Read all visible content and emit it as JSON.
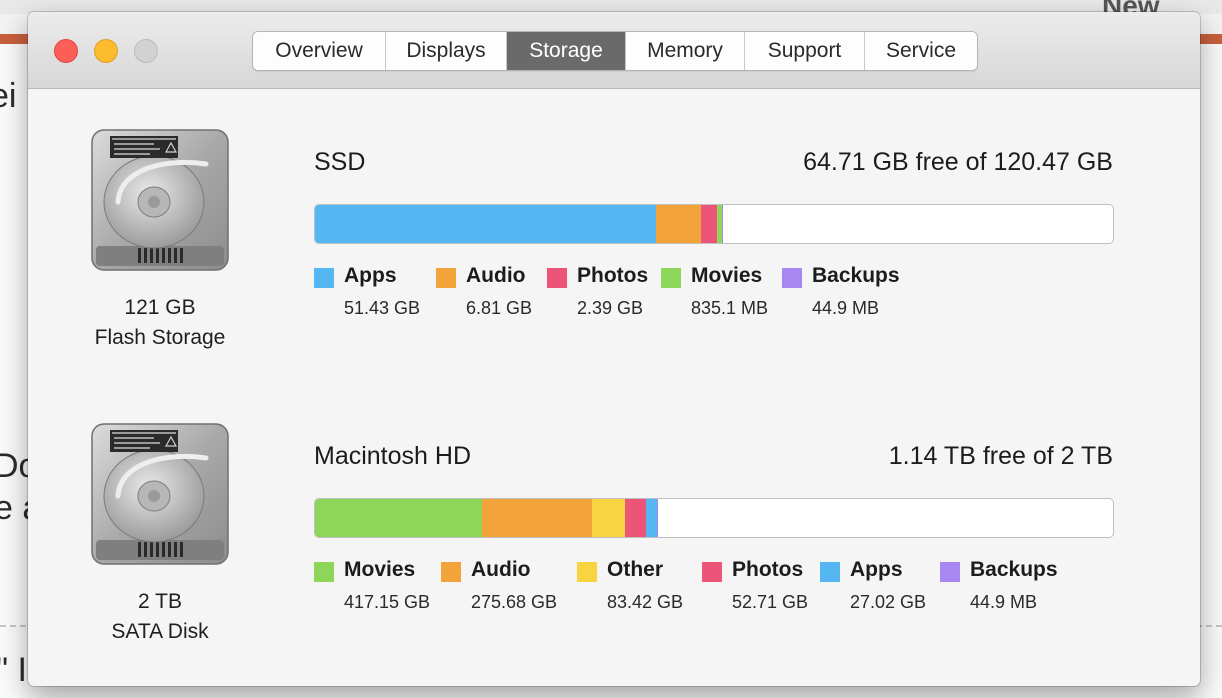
{
  "background": {
    "fragments": [
      "ei",
      "Do",
      "e a",
      "\" I"
    ],
    "header_fragment": "New"
  },
  "window": {
    "traffic_lights": [
      "close-button",
      "minimize-button",
      "zoom-button"
    ],
    "tabs": [
      {
        "label": "Overview",
        "active": false
      },
      {
        "label": "Displays",
        "active": false
      },
      {
        "label": "Storage",
        "active": true
      },
      {
        "label": "Memory",
        "active": false
      },
      {
        "label": "Support",
        "active": false
      },
      {
        "label": "Service",
        "active": false
      }
    ]
  },
  "drives": [
    {
      "icon": "hard-drive-icon",
      "capacity": "121 GB",
      "type": "Flash Storage",
      "name": "SSD",
      "free_text": "64.71 GB free of 120.47 GB",
      "usage_fractions": [
        {
          "category": "Apps",
          "fraction": 0.4269,
          "color": "#55b7f2"
        },
        {
          "category": "Audio",
          "fraction": 0.0565,
          "color": "#f2a43b"
        },
        {
          "category": "Photos",
          "fraction": 0.0198,
          "color": "#ec5578"
        },
        {
          "category": "Movies",
          "fraction": 0.0069,
          "color": "#8ed65a"
        },
        {
          "category": "Backups",
          "fraction": 0.0004,
          "color": "#a787f0"
        }
      ],
      "legend": [
        {
          "label": "Apps",
          "size": "51.43 GB",
          "color": "#55b7f2"
        },
        {
          "label": "Audio",
          "size": "6.81 GB",
          "color": "#f2a43b"
        },
        {
          "label": "Photos",
          "size": "2.39 GB",
          "color": "#ec5578"
        },
        {
          "label": "Movies",
          "size": "835.1 MB",
          "color": "#8ed65a"
        },
        {
          "label": "Backups",
          "size": "44.9 MB",
          "color": "#a787f0"
        }
      ]
    },
    {
      "icon": "hard-drive-icon",
      "capacity": "2 TB",
      "type": "SATA Disk",
      "name": "Macintosh HD",
      "free_text": "1.14 TB free of 2 TB",
      "usage_fractions": [
        {
          "category": "Movies",
          "fraction": 0.2086,
          "color": "#8ed65a"
        },
        {
          "category": "Audio",
          "fraction": 0.1378,
          "color": "#f2a43b"
        },
        {
          "category": "Other",
          "fraction": 0.0417,
          "color": "#f8d443"
        },
        {
          "category": "Photos",
          "fraction": 0.0264,
          "color": "#ec5578"
        },
        {
          "category": "Apps",
          "fraction": 0.0135,
          "color": "#55b7f2"
        },
        {
          "category": "Backups",
          "fraction": 2e-05,
          "color": "#a787f0"
        }
      ],
      "legend": [
        {
          "label": "Movies",
          "size": "417.15 GB",
          "color": "#8ed65a"
        },
        {
          "label": "Audio",
          "size": "275.68 GB",
          "color": "#f2a43b"
        },
        {
          "label": "Other",
          "size": "83.42 GB",
          "color": "#f8d443"
        },
        {
          "label": "Photos",
          "size": "52.71 GB",
          "color": "#ec5578"
        },
        {
          "label": "Apps",
          "size": "27.02 GB",
          "color": "#55b7f2"
        },
        {
          "label": "Backups",
          "size": "44.9 MB",
          "color": "#a787f0"
        }
      ]
    }
  ]
}
